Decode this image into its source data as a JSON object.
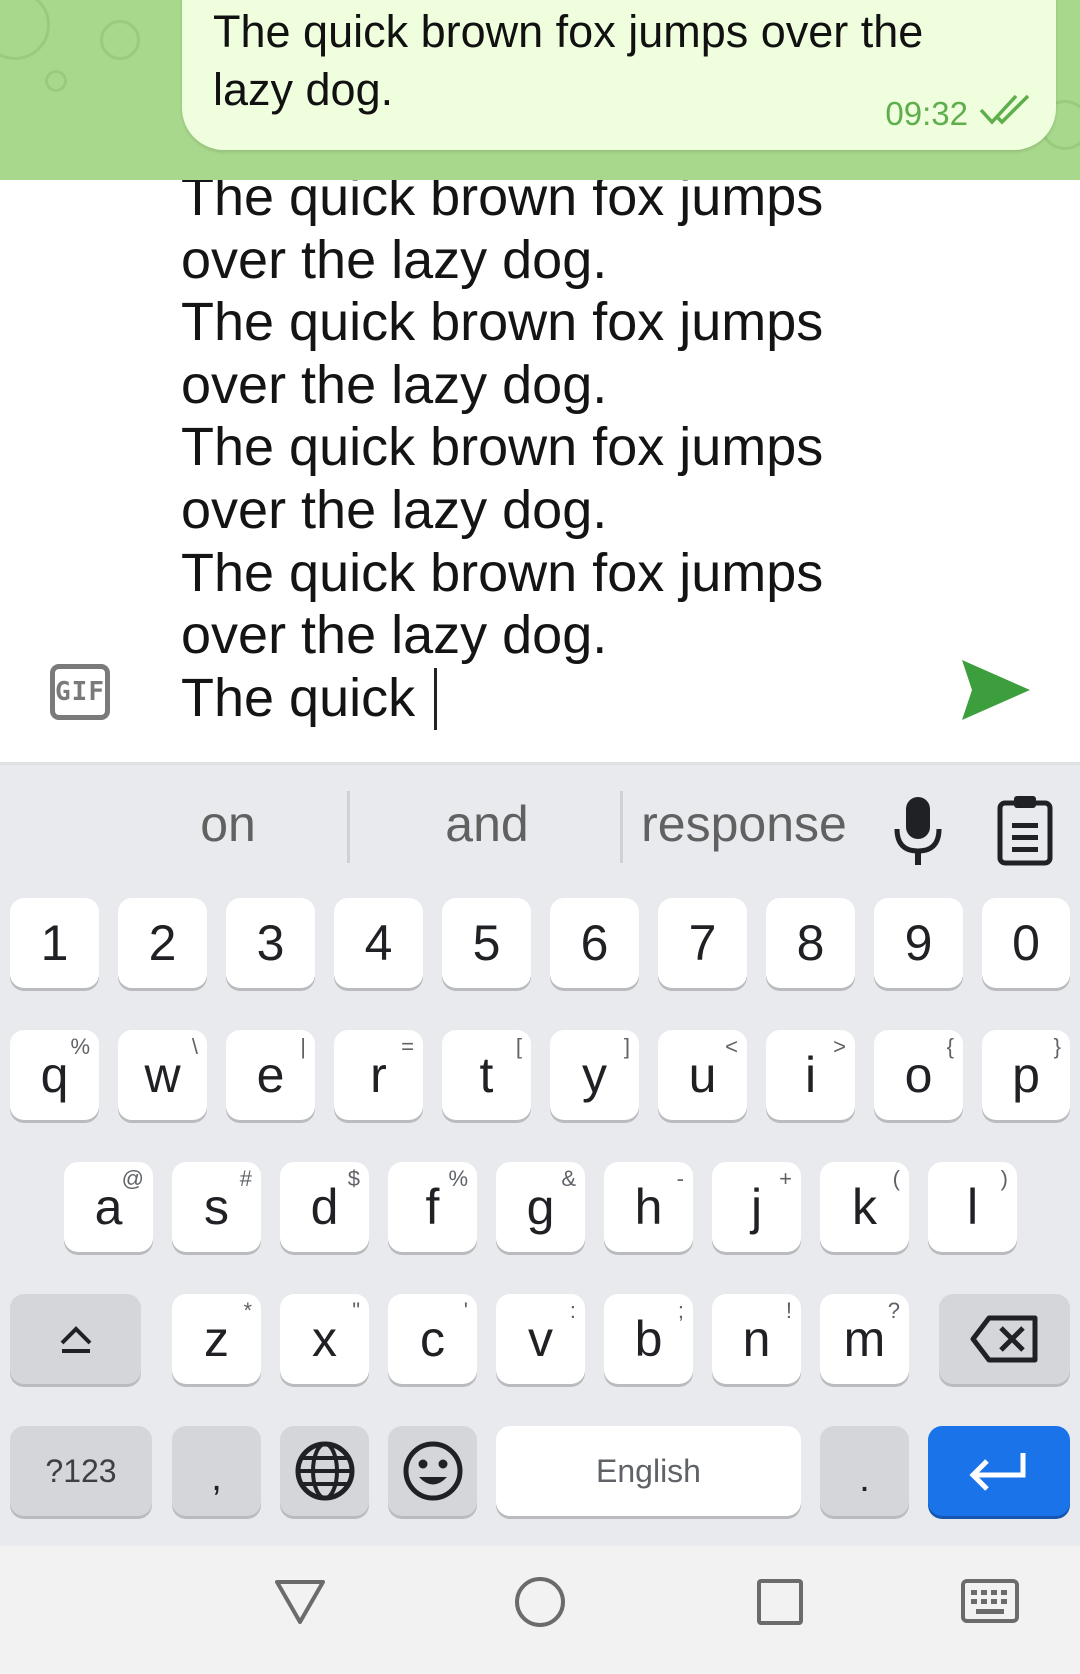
{
  "chat": {
    "message": {
      "text": "The quick brown fox jumps over the lazy dog.",
      "time": "09:32",
      "status_icon": "double-check-icon"
    }
  },
  "composer": {
    "text": "The quick brown fox jumps\nover the lazy dog.\nThe quick brown fox jumps\nover the lazy dog.\nThe quick brown fox jumps\nover the lazy dog.\nThe quick brown fox jumps\nover the lazy dog.\nThe quick ",
    "gif_label": "GIF",
    "send_icon": "send-icon",
    "accent_color": "#3d9e3d"
  },
  "keyboard": {
    "suggestions": [
      "on",
      "and",
      "response"
    ],
    "number_row": [
      "1",
      "2",
      "3",
      "4",
      "5",
      "6",
      "7",
      "8",
      "9",
      "0"
    ],
    "row1": [
      {
        "key": "q",
        "hint": "%"
      },
      {
        "key": "w",
        "hint": "\\"
      },
      {
        "key": "e",
        "hint": "|"
      },
      {
        "key": "r",
        "hint": "="
      },
      {
        "key": "t",
        "hint": "["
      },
      {
        "key": "y",
        "hint": "]"
      },
      {
        "key": "u",
        "hint": "<"
      },
      {
        "key": "i",
        "hint": ">"
      },
      {
        "key": "o",
        "hint": "{"
      },
      {
        "key": "p",
        "hint": "}"
      }
    ],
    "row2": [
      {
        "key": "a",
        "hint": "@"
      },
      {
        "key": "s",
        "hint": "#"
      },
      {
        "key": "d",
        "hint": "$"
      },
      {
        "key": "f",
        "hint": "%"
      },
      {
        "key": "g",
        "hint": "&"
      },
      {
        "key": "h",
        "hint": "-"
      },
      {
        "key": "j",
        "hint": "+"
      },
      {
        "key": "k",
        "hint": "("
      },
      {
        "key": "l",
        "hint": ")"
      }
    ],
    "row3": [
      {
        "key": "z",
        "hint": "*"
      },
      {
        "key": "x",
        "hint": "\""
      },
      {
        "key": "c",
        "hint": "'"
      },
      {
        "key": "v",
        "hint": ":"
      },
      {
        "key": "b",
        "hint": ";"
      },
      {
        "key": "n",
        "hint": "!"
      },
      {
        "key": "m",
        "hint": "?"
      }
    ],
    "bottom": {
      "symbols_label": "?123",
      "comma": ",",
      "space_label": "English",
      "period": "."
    },
    "enter_color": "#1a73e8"
  },
  "navigation": [
    "back-icon",
    "home-icon",
    "recents-icon",
    "keyboard-switch-icon"
  ]
}
